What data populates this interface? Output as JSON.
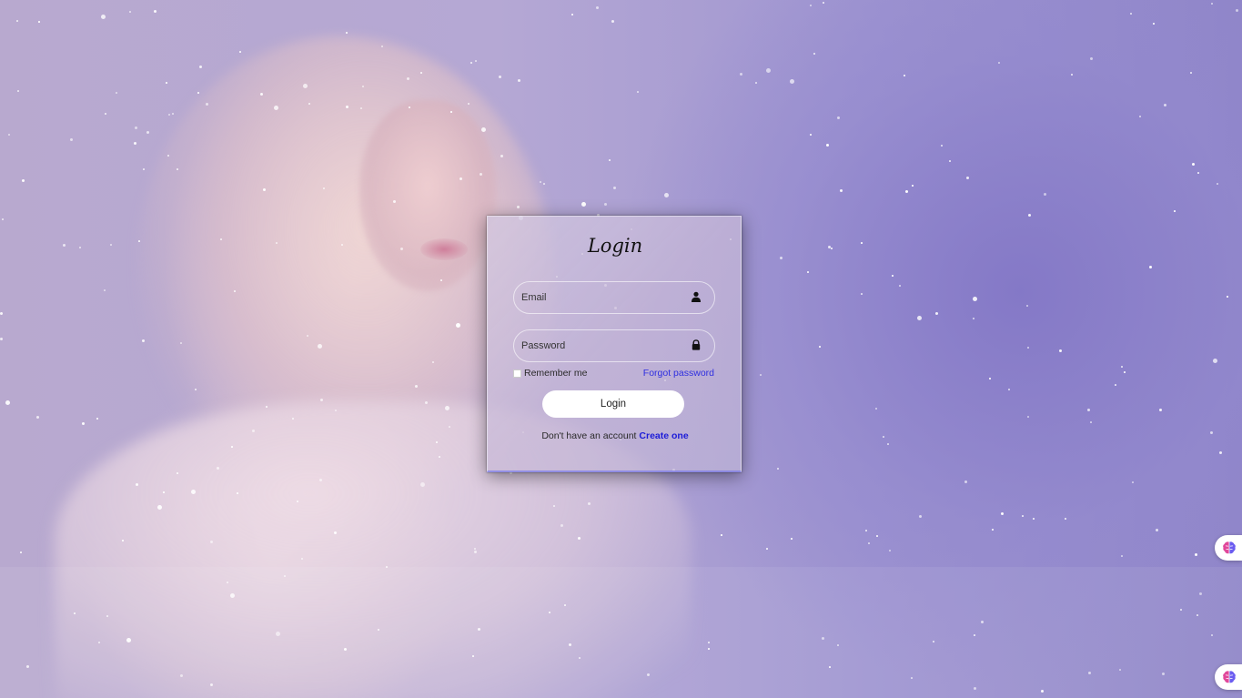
{
  "login_card": {
    "title": "Login",
    "email": {
      "placeholder": "Email",
      "icon": "user-icon"
    },
    "password": {
      "placeholder": "Password",
      "icon": "lock-icon"
    },
    "remember_label": "Remember me",
    "forgot_label": "Forgot password",
    "login_button": "Login",
    "signup_prompt": "Don't have an account",
    "signup_link": "Create one"
  },
  "widgets": [
    {
      "icon": "brain-icon"
    },
    {
      "icon": "brain-icon"
    }
  ],
  "colors": {
    "link": "#2f2fe0",
    "signup_link": "#1c1cd8",
    "button_bg": "#ffffff",
    "background_accent": "#9f95d1"
  }
}
